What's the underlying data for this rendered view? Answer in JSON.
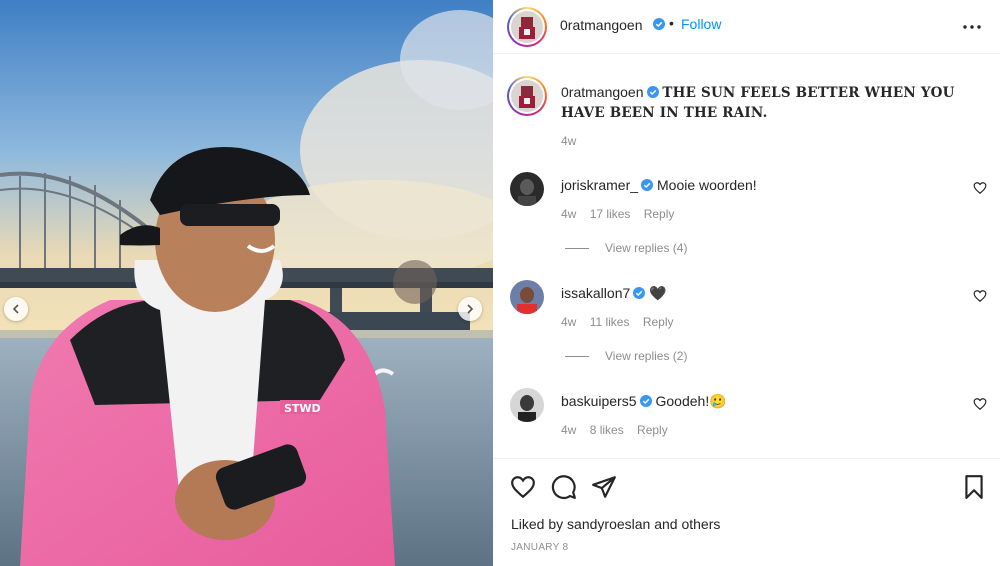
{
  "post": {
    "username": "0ratmangoen",
    "follow_label": "Follow",
    "separator": "•",
    "caption": "THE SUN FEELS BETTER WHEN YOU HAVE BEEN IN THE RAIN.",
    "caption_time": "4w",
    "liked_by_prefix": "Liked by",
    "liked_by_user": "sandyroeslan",
    "liked_by_suffix": "and others",
    "date": "JANUARY 8"
  },
  "comments": [
    {
      "username": "joriskramer_",
      "text": "Mooie woorden!",
      "time": "4w",
      "likes": "17 likes",
      "reply": "Reply",
      "view_replies": "View replies (4)"
    },
    {
      "username": "issakallon7",
      "text": "🖤",
      "time": "4w",
      "likes": "11 likes",
      "reply": "Reply",
      "view_replies": "View replies (2)"
    },
    {
      "username": "baskuipers5",
      "text": "Goodeh!🥲",
      "time": "4w",
      "likes": "8 likes",
      "reply": "Reply"
    }
  ],
  "icons": {
    "more": "more-horizontal-icon",
    "like": "heart-icon",
    "comment": "comment-icon",
    "share": "paper-plane-icon",
    "save": "bookmark-icon",
    "verified": "verified-badge-icon",
    "prev": "chevron-left-icon",
    "next": "chevron-right-icon"
  },
  "colors": {
    "link": "#0095f6",
    "verified": "#3897f0",
    "text": "#262626",
    "muted": "#8e8e8e",
    "jacket": "#f06aa6"
  }
}
